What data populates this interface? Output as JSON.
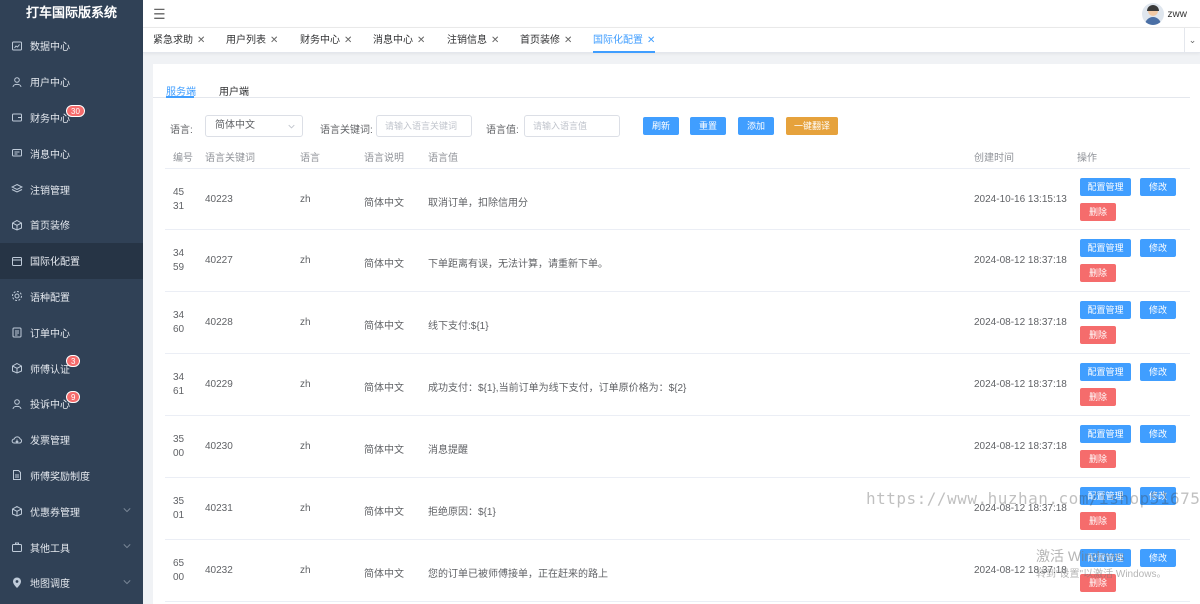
{
  "app": {
    "title": "打车国际版系统"
  },
  "sidebar": {
    "items": [
      {
        "label": "数据中心",
        "icon": "dashboard-icon"
      },
      {
        "label": "用户中心",
        "icon": "user-icon"
      },
      {
        "label": "财务中心",
        "icon": "wallet-icon",
        "badge": "30"
      },
      {
        "label": "消息中心",
        "icon": "message-icon"
      },
      {
        "label": "注销管理",
        "icon": "layers-icon"
      },
      {
        "label": "首页装修",
        "icon": "box-icon"
      },
      {
        "label": "国际化配置",
        "icon": "calendar-icon",
        "active": true
      },
      {
        "label": "语种配置",
        "icon": "gear-icon"
      },
      {
        "label": "订单中心",
        "icon": "clipboard-icon"
      },
      {
        "label": "师傅认证",
        "icon": "box-icon",
        "badge": "3"
      },
      {
        "label": "投诉中心",
        "icon": "user-icon",
        "badge": "9"
      },
      {
        "label": "发票管理",
        "icon": "cloud-icon"
      },
      {
        "label": "师傅奖励制度",
        "icon": "document-icon"
      },
      {
        "label": "优惠券管理",
        "icon": "box-icon",
        "expandable": true
      },
      {
        "label": "其他工具",
        "icon": "briefcase-icon",
        "expandable": true
      },
      {
        "label": "地图调度",
        "icon": "location-icon",
        "expandable": true
      }
    ]
  },
  "header": {
    "username": "zww"
  },
  "tabs": [
    {
      "label": "紧急求助"
    },
    {
      "label": "用户列表"
    },
    {
      "label": "财务中心"
    },
    {
      "label": "消息中心"
    },
    {
      "label": "注销信息"
    },
    {
      "label": "首页装修"
    },
    {
      "label": "国际化配置",
      "active": true
    }
  ],
  "subtabs": {
    "server": "服务端",
    "client": "用户端"
  },
  "filters": {
    "language_label": "语言:",
    "language_value": "简体中文",
    "keyword_label": "语言关键词:",
    "keyword_placeholder": "请输入语言关键词",
    "value_label": "语言值:",
    "value_placeholder": "请输入语言值"
  },
  "actions": {
    "refresh": "刷新",
    "reset": "重置",
    "add": "添加",
    "translate": "一键翻译"
  },
  "table": {
    "columns": {
      "id": "编号",
      "keyword": "语言关键词",
      "language": "语言",
      "description": "语言说明",
      "value": "语言值",
      "created": "创建时间",
      "operation": "操作"
    },
    "row_actions": {
      "config": "配置管理",
      "edit": "修改",
      "delete": "删除"
    },
    "rows": [
      {
        "id": "4531",
        "keyword": "40223",
        "language": "zh",
        "description": "简体中文",
        "value": "取消订单，扣除信用分",
        "created": "2024-10-16 13:15:13"
      },
      {
        "id": "3459",
        "keyword": "40227",
        "language": "zh",
        "description": "简体中文",
        "value": "下单距离有误，无法计算，请重新下单。",
        "created": "2024-08-12 18:37:18"
      },
      {
        "id": "3460",
        "keyword": "40228",
        "language": "zh",
        "description": "简体中文",
        "value": "线下支付:${1}",
        "created": "2024-08-12 18:37:18"
      },
      {
        "id": "3461",
        "keyword": "40229",
        "language": "zh",
        "description": "简体中文",
        "value": "成功支付：${1},当前订单为线下支付，订单原价格为：${2}",
        "created": "2024-08-12 18:37:18"
      },
      {
        "id": "3500",
        "keyword": "40230",
        "language": "zh",
        "description": "简体中文",
        "value": "消息提醒",
        "created": "2024-08-12 18:37:18"
      },
      {
        "id": "3501",
        "keyword": "40231",
        "language": "zh",
        "description": "简体中文",
        "value": "拒绝原因：${1}",
        "created": "2024-08-12 18:37:18"
      },
      {
        "id": "6500",
        "keyword": "40232",
        "language": "zh",
        "description": "简体中文",
        "value": "您的订单已被师傅接单，正在赶来的路上",
        "created": "2024-08-12 18:37:18"
      }
    ]
  },
  "overlay": {
    "watermark": "https://www.huzhan.com/ishop51675",
    "activate_title": "激活 Windows",
    "activate_hint": "转到\"设置\"以激活 Windows。"
  },
  "colors": {
    "sidebar_bg": "#304156",
    "primary": "#409eff",
    "danger": "#f56c6c",
    "warning": "#e6a23c"
  }
}
